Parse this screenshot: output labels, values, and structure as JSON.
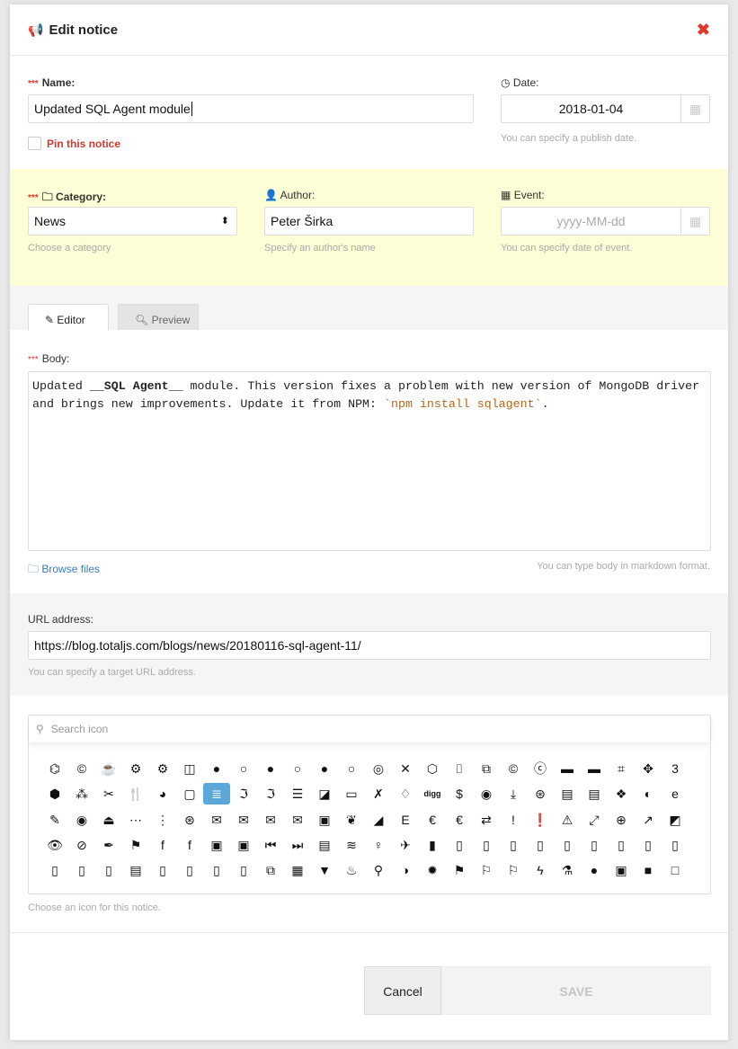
{
  "header": {
    "title": "Edit notice",
    "icon": "bullhorn-icon",
    "close": "✖"
  },
  "name": {
    "required": "***",
    "label": "Name:",
    "value": "Updated SQL Agent module",
    "pin_label": "Pin this notice",
    "pinned": false
  },
  "date": {
    "label": "Date:",
    "value": "2018-01-04",
    "help": "You can specify a publish date."
  },
  "category": {
    "required": "***",
    "label": "Category:",
    "value": "News",
    "help": "Choose a category"
  },
  "author": {
    "label": "Author:",
    "value": "Peter Širka",
    "help": "Specify an author's name"
  },
  "event": {
    "label": "Event:",
    "placeholder": "yyyy-MM-dd",
    "help": "You can specify date of event."
  },
  "tabs": [
    {
      "label": "Editor",
      "active": true
    },
    {
      "label": "Preview",
      "active": false
    }
  ],
  "body": {
    "required": "***",
    "label": "Body:",
    "text_1": "Updated ",
    "bold": "__SQL Agent__",
    "text_2": " module. This version fixes a problem with new version of MongoDB driver and brings new improvements. Update it from NPM: ",
    "code": "`npm install sqlagent`",
    "text_3": ".",
    "browse": "Browse files",
    "help": "You can type body in markdown format."
  },
  "url": {
    "label": "URL address:",
    "value": "https://blog.totaljs.com/blogs/news/20180116-sql-agent-11/",
    "help": "You can specify a target URL address."
  },
  "icons": {
    "search_placeholder": "Search icon",
    "help": "Choose an icon for this notice.",
    "selected": "database",
    "rows": [
      [
        "⌬",
        "©",
        "☕",
        "⚙",
        "⚙",
        "◫",
        "●",
        "○",
        "●",
        "○",
        "●",
        "○",
        "◎",
        "✕",
        "⬡",
        "⌷",
        "⧉",
        "©",
        "ⓒ",
        "▬",
        "▬",
        "⌗",
        "✥",
        "3"
      ],
      [
        "⬢",
        "⁂",
        "✂",
        "🍴",
        "◕",
        "▢",
        "☰",
        "ℑ",
        "ℑ",
        "☰",
        "◪",
        "▭",
        "✗",
        "♢",
        "digg",
        "$",
        "◉",
        "⤓",
        "⊛",
        "▤",
        "▤",
        "❖",
        "◐",
        "e"
      ],
      [
        "✎",
        "◉",
        "⏏",
        "⋯",
        "⋮",
        "⊛",
        "✉",
        "✉",
        "✉",
        "✉",
        "▣",
        "❦",
        "◢",
        "E",
        "€",
        "€",
        "⇄",
        "!",
        "❗",
        "⚠",
        "⤢",
        "⊕",
        "↗",
        "◩"
      ],
      [
        "👁",
        "⊘",
        "✒",
        "⚑",
        "f",
        "f",
        "▣",
        "▣",
        "⏮",
        "⏭",
        "▤",
        "≋",
        "♀",
        "✈",
        "▮",
        "▯",
        "▯",
        "▯",
        "▯",
        "▯",
        "▯",
        "▯",
        "▯",
        "▯"
      ],
      [
        "▯",
        "▯",
        "▯",
        "▤",
        "▯",
        "▯",
        "▯",
        "▯",
        "⧉",
        "▦",
        "▼",
        "♨",
        "⚲",
        "◑",
        "✹",
        "⚑",
        "⚐",
        "⚐",
        "ϟ",
        "⚗",
        "●",
        "▣",
        "■",
        "□"
      ]
    ]
  },
  "footer": {
    "cancel": "Cancel",
    "save": "SAVE"
  }
}
